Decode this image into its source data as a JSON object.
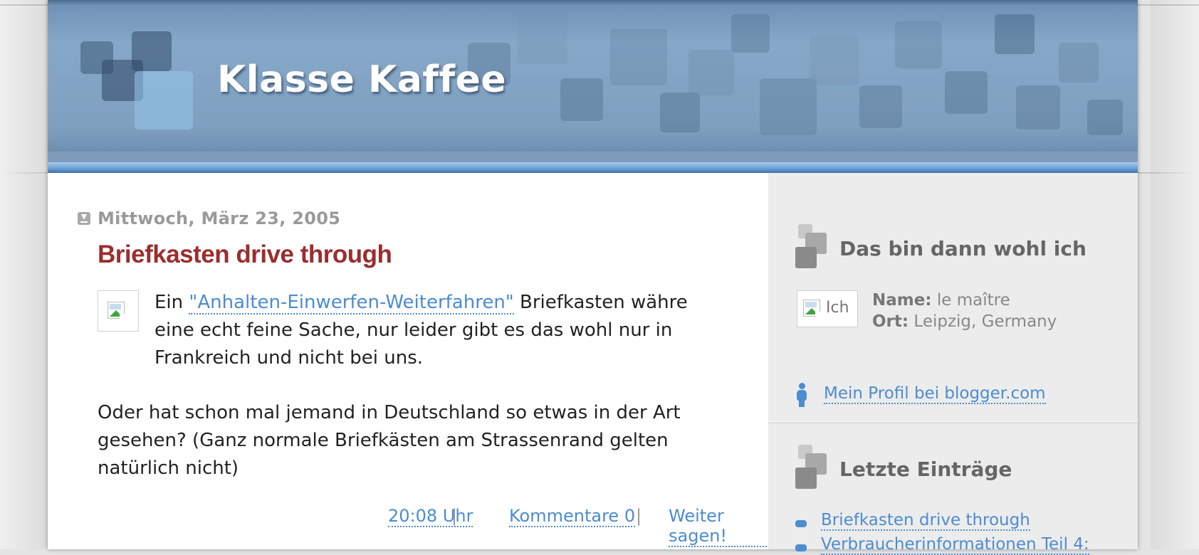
{
  "blog": {
    "title": "Klasse Kaffee"
  },
  "post": {
    "date": "Mittwoch, März 23, 2005",
    "title": "Briefkasten drive through",
    "body_intro": "Ein ",
    "body_link": "\"Anhalten-Einwerfen-Weiterfahren\"",
    "body_rest": " Briefkasten währe eine echt feine Sache, nur leider gibt es das wohl nur in Frankreich und nicht bei uns.",
    "body_second": "Oder hat schon mal jemand in Deutschland so etwas in der Art gesehen? (Ganz normale Briefkästen am Strassenrand gelten natürlich nicht)",
    "footer": {
      "time": "20:08 Uhr",
      "separator": "|",
      "comments": "Kommentare 0",
      "share": "Weiter sagen!"
    }
  },
  "sidebar": {
    "about": {
      "title": "Das bin dann wohl ich",
      "image_alt": "Ich",
      "name_label": "Name:",
      "name_value": "le maître",
      "location_label": "Ort:",
      "location_value": "Leipzig, Germany",
      "profile_link": "Mein Profil bei blogger.com"
    },
    "recent": {
      "title": "Letzte Einträge",
      "items": [
        {
          "label": "Briefkasten drive through"
        },
        {
          "label": "Verbraucherinformationen Teil 4:"
        }
      ]
    }
  },
  "colors": {
    "post_title": "#9a2e2e",
    "link": "#4c8cd0",
    "header_blue": "#86a8c8"
  }
}
